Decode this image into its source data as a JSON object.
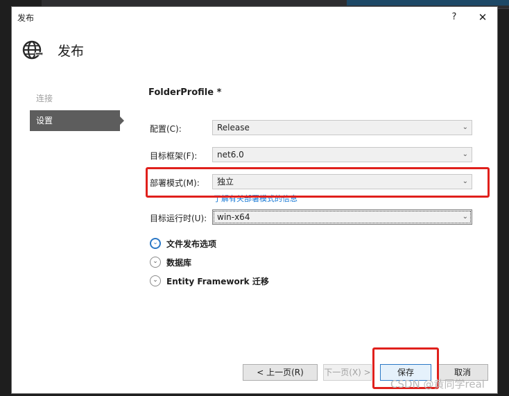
{
  "window": {
    "title": "发布",
    "help_label": "?",
    "close_label": "✕"
  },
  "header": {
    "title": "发布",
    "icon": "globe-icon"
  },
  "nav": {
    "items": [
      {
        "label": "连接"
      },
      {
        "label": "设置"
      }
    ],
    "selected": "设置"
  },
  "profile": {
    "title": "FolderProfile *"
  },
  "fields": {
    "config": {
      "label": "配置(C):",
      "value": "Release"
    },
    "framework": {
      "label": "目标框架(F):",
      "value": "net6.0"
    },
    "deploy_mode": {
      "label": "部署模式(M):",
      "value": "独立",
      "help_link": "了解有关部署模式的信息"
    },
    "runtime": {
      "label": "目标运行时(U):",
      "value": "win-x64"
    }
  },
  "sections": [
    {
      "label": "文件发布选项",
      "expanded": true
    },
    {
      "label": "数据库",
      "expanded": false
    },
    {
      "label": "Entity Framework 迁移",
      "expanded": false
    }
  ],
  "buttons": {
    "prev": "< 上一页(R)",
    "next": "下一页(X) >",
    "save": "保存",
    "cancel": "取消"
  },
  "watermark": "CSDN @黄同学real",
  "colors": {
    "highlight": "#e0201c",
    "accent": "#2b78c6",
    "nav_selected": "#5d5d5d"
  }
}
